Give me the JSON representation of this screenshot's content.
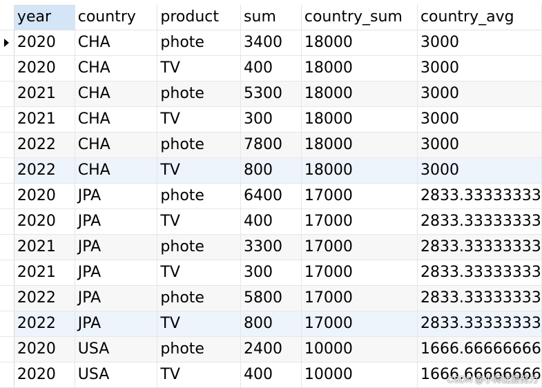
{
  "grid": {
    "columns": [
      "year",
      "country",
      "product",
      "sum",
      "country_sum",
      "country_avg"
    ],
    "sorted_column": "year",
    "current_row": 0,
    "rows": [
      [
        "2020",
        "CHA",
        "phote",
        "3400",
        "18000",
        "3000"
      ],
      [
        "2020",
        "CHA",
        "TV",
        "400",
        "18000",
        "3000"
      ],
      [
        "2021",
        "CHA",
        "phote",
        "5300",
        "18000",
        "3000"
      ],
      [
        "2021",
        "CHA",
        "TV",
        "300",
        "18000",
        "3000"
      ],
      [
        "2022",
        "CHA",
        "phote",
        "7800",
        "18000",
        "3000"
      ],
      [
        "2022",
        "CHA",
        "TV",
        "800",
        "18000",
        "3000"
      ],
      [
        "2020",
        "JPA",
        "phote",
        "6400",
        "17000",
        "2833.33333333"
      ],
      [
        "2020",
        "JPA",
        "TV",
        "400",
        "17000",
        "2833.33333333"
      ],
      [
        "2021",
        "JPA",
        "phote",
        "3300",
        "17000",
        "2833.33333333"
      ],
      [
        "2021",
        "JPA",
        "TV",
        "300",
        "17000",
        "2833.33333333"
      ],
      [
        "2022",
        "JPA",
        "phote",
        "5800",
        "17000",
        "2833.33333333"
      ],
      [
        "2022",
        "JPA",
        "TV",
        "800",
        "17000",
        "2833.33333333"
      ],
      [
        "2020",
        "USA",
        "phote",
        "2400",
        "10000",
        "1666.66666666"
      ],
      [
        "2020",
        "USA",
        "TV",
        "400",
        "10000",
        "1666.66666666"
      ]
    ],
    "highlighted_rows": [
      5,
      11
    ],
    "alternate_rows": [
      2,
      4,
      8,
      10,
      12
    ]
  },
  "watermark": {
    "text": "CSDN @小帅比要努力"
  },
  "colors": {
    "header_selected": "#d3e5f6",
    "row_highlight": "#eef4fb",
    "row_alternate": "#f7f7f7",
    "gridline": "#e6e6e6"
  }
}
